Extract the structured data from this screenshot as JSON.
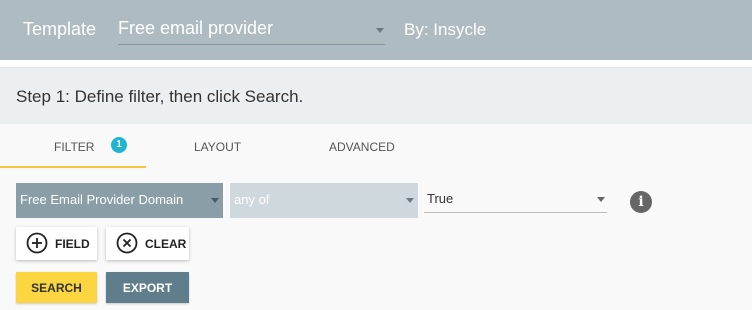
{
  "header": {
    "template_label": "Template",
    "template_value": "Free email provider",
    "by_label": "By: Insycle"
  },
  "step": {
    "text": "Step 1: Define filter, then click Search."
  },
  "tabs": [
    {
      "label": "FILTER",
      "badge": "1",
      "active": true
    },
    {
      "label": "LAYOUT",
      "active": false
    },
    {
      "label": "ADVANCED",
      "active": false
    }
  ],
  "filter": {
    "field": "Free Email Provider Domain",
    "operator": "any of",
    "value": "True"
  },
  "buttons": {
    "add_field": "FIELD",
    "clear": "CLEAR",
    "search": "SEARCH",
    "export": "EXPORT"
  },
  "icons": {
    "info": "info-icon",
    "add": "add-circle-icon",
    "clear": "close-circle-icon",
    "dropdown": "chevron-down-icon"
  },
  "colors": {
    "header_bg": "#aebcc2",
    "active_tab_underline": "#f5c842",
    "badge": "#1fb5d1",
    "search_button": "#fbd641",
    "export_button": "#607d8b"
  }
}
